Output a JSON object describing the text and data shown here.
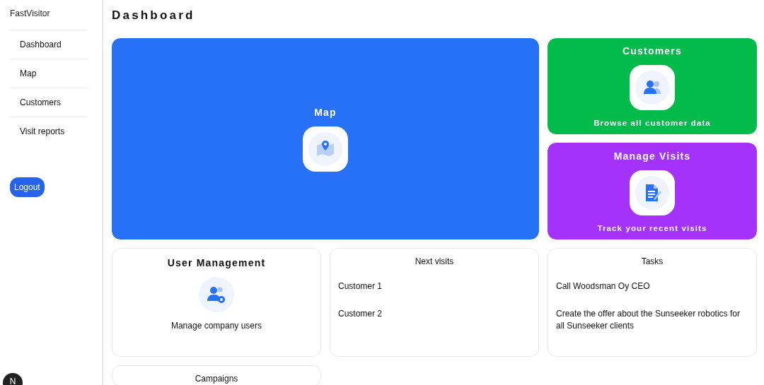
{
  "sidebar": {
    "brand": "FastVisitor",
    "items": [
      {
        "label": "Dashboard"
      },
      {
        "label": "Map"
      },
      {
        "label": "Customers"
      },
      {
        "label": "Visit reports"
      }
    ],
    "logout": "Logout"
  },
  "page_title": "Dashboard",
  "tiles": [
    {
      "kind": "feature",
      "title": "Map",
      "color": "#2671f5"
    },
    {
      "kind": "feature",
      "title": "Customers",
      "subtitle": "Browse all customer data",
      "color": "#03bb4b"
    },
    {
      "kind": "feature",
      "title": "Manage Visits",
      "subtitle": "Track your recent visits",
      "color": "#a532fb"
    },
    {
      "kind": "card",
      "title": "User Management",
      "subtitle": "Manage company users"
    },
    {
      "kind": "list",
      "title": "Next visits",
      "items": [
        "Customer 1",
        "Customer 2"
      ]
    },
    {
      "kind": "list",
      "title": "Tasks",
      "items": [
        "Call Woodsman Oy CEO",
        "Create the offer about the Sunseeker robotics for all Sunseeker clients"
      ]
    },
    {
      "kind": "list",
      "title": "Campaigns"
    }
  ],
  "dev_badge": "N"
}
